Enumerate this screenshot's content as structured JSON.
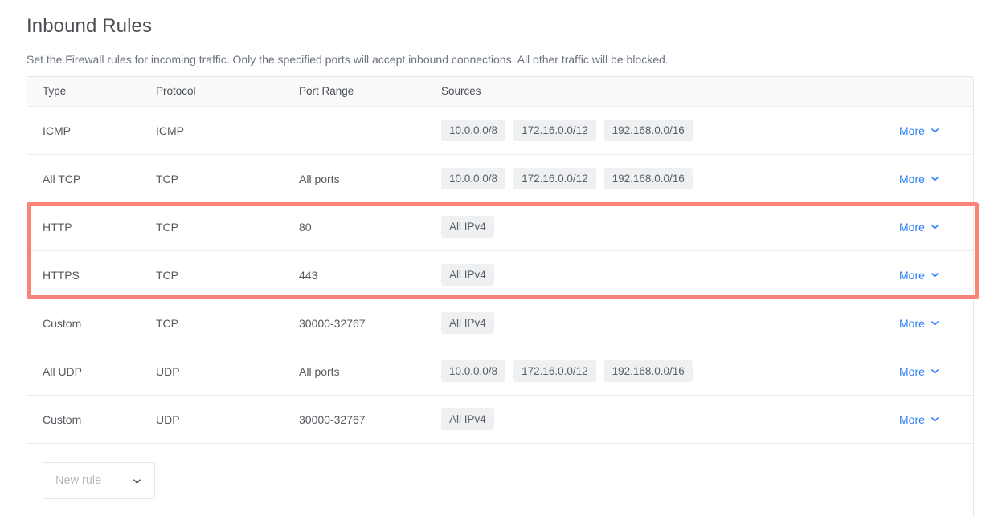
{
  "header": {
    "title": "Inbound Rules",
    "description": "Set the Firewall rules for incoming traffic. Only the specified ports will accept inbound connections. All other traffic will be blocked."
  },
  "table": {
    "columns": {
      "type": "Type",
      "protocol": "Protocol",
      "port_range": "Port Range",
      "sources": "Sources",
      "more": ""
    },
    "rows": [
      {
        "type": "ICMP",
        "protocol": "ICMP",
        "port_range": "",
        "sources": [
          "10.0.0.0/8",
          "172.16.0.0/12",
          "192.168.0.0/16"
        ],
        "more_label": "More"
      },
      {
        "type": "All TCP",
        "protocol": "TCP",
        "port_range": "All ports",
        "sources": [
          "10.0.0.0/8",
          "172.16.0.0/12",
          "192.168.0.0/16"
        ],
        "more_label": "More"
      },
      {
        "type": "HTTP",
        "protocol": "TCP",
        "port_range": "80",
        "sources": [
          "All IPv4"
        ],
        "more_label": "More"
      },
      {
        "type": "HTTPS",
        "protocol": "TCP",
        "port_range": "443",
        "sources": [
          "All IPv4"
        ],
        "more_label": "More"
      },
      {
        "type": "Custom",
        "protocol": "TCP",
        "port_range": "30000-32767",
        "sources": [
          "All IPv4"
        ],
        "more_label": "More"
      },
      {
        "type": "All UDP",
        "protocol": "UDP",
        "port_range": "All ports",
        "sources": [
          "10.0.0.0/8",
          "172.16.0.0/12",
          "192.168.0.0/16"
        ],
        "more_label": "More"
      },
      {
        "type": "Custom",
        "protocol": "UDP",
        "port_range": "30000-32767",
        "sources": [
          "All IPv4"
        ],
        "more_label": "More"
      }
    ]
  },
  "footer": {
    "new_rule_placeholder": "New rule"
  },
  "highlight": {
    "color": "#f98279",
    "target_rows": [
      "HTTP",
      "HTTPS"
    ]
  },
  "colors": {
    "link": "#2d7ff9",
    "pill_bg": "#eef0f1",
    "header_bg": "#fafafa",
    "border": "#e5e7ea",
    "highlight": "#f98279",
    "text": "#55595e",
    "muted": "#6b7280"
  }
}
